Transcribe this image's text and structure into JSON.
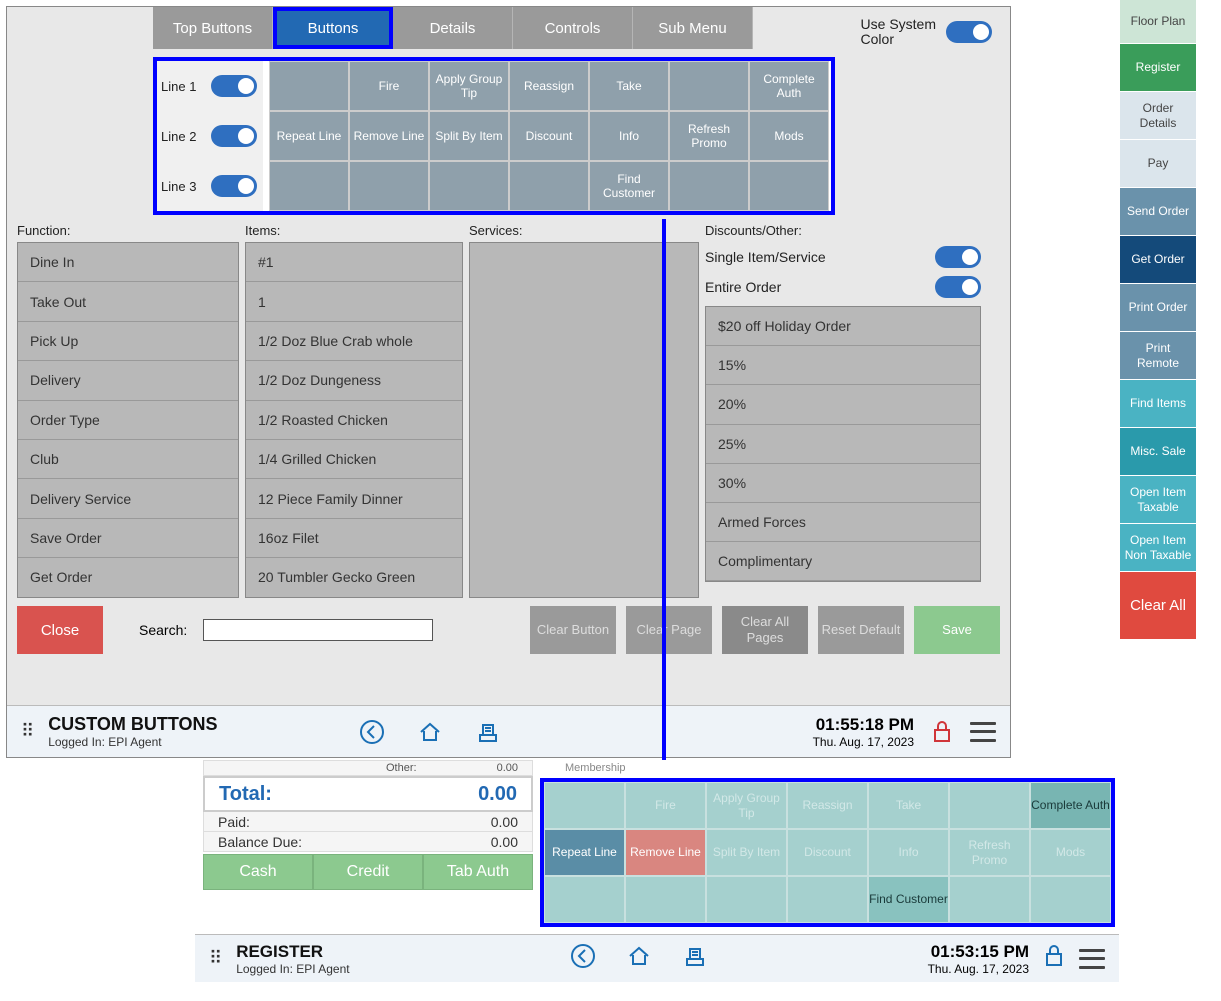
{
  "tabs": [
    "Top Buttons",
    "Buttons",
    "Details",
    "Controls",
    "Sub Menu"
  ],
  "activeTab": "Buttons",
  "systemColor": {
    "label": "Use System\nColor"
  },
  "lines": [
    {
      "label": "Line 1",
      "cells": [
        "",
        "Fire",
        "Apply Group Tip",
        "Reassign",
        "Take",
        "",
        "Complete Auth"
      ]
    },
    {
      "label": "Line 2",
      "cells": [
        "Repeat Line",
        "Remove Line",
        "Split By Item",
        "Discount",
        "Info",
        "Refresh Promo",
        "Mods"
      ]
    },
    {
      "label": "Line 3",
      "cells": [
        "",
        "",
        "",
        "",
        "Find Customer",
        "",
        ""
      ]
    }
  ],
  "columns": {
    "function": {
      "label": "Function:",
      "items": [
        "Dine In",
        "Take Out",
        "Pick Up",
        "Delivery",
        "Order Type",
        "Club",
        "Delivery Service",
        "Save Order",
        "Get Order"
      ]
    },
    "items": {
      "label": "Items:",
      "items": [
        "#1",
        "1",
        "1/2 Doz Blue Crab whole",
        "1/2 Doz Dungeness",
        "1/2 Roasted Chicken",
        "1/4 Grilled Chicken",
        "12 Piece Family Dinner",
        "16oz Filet",
        "20 Tumbler Gecko Green"
      ]
    },
    "services": {
      "label": "Services:",
      "items": []
    },
    "discounts": {
      "label": "Discounts/Other:",
      "single": "Single Item/Service",
      "entire": "Entire Order",
      "items": [
        "$20 off Holiday Order",
        "15%",
        "20%",
        "25%",
        "30%",
        "Armed Forces",
        "Complimentary"
      ]
    }
  },
  "actions": {
    "close": "Close",
    "searchLabel": "Search:",
    "clearButton": "Clear Button",
    "clearPage": "Clear Page",
    "clearAllPages": "Clear All Pages",
    "resetDefault": "Reset Default",
    "save": "Save"
  },
  "status1": {
    "title": "CUSTOM BUTTONS",
    "sub": "Logged In:  EPI Agent",
    "time": "01:55:18 PM",
    "date": "Thu. Aug. 17, 2023"
  },
  "panel2": {
    "topOther": "Other:",
    "topVal": "0.00",
    "totals": [
      {
        "label": "Total:",
        "value": "0.00",
        "big": true
      },
      {
        "label": "Paid:",
        "value": "0.00"
      },
      {
        "label": "Balance Due:",
        "value": "0.00"
      }
    ],
    "payButtons": [
      "Cash",
      "Credit",
      "Tab Auth"
    ],
    "tealRows": [
      [
        {
          "t": ""
        },
        {
          "t": "Fire"
        },
        {
          "t": "Apply Group Tip"
        },
        {
          "t": "Reassign"
        },
        {
          "t": "Take"
        },
        {
          "t": ""
        },
        {
          "t": "Complete Auth",
          "cls": "comp"
        }
      ],
      [
        {
          "t": "Repeat Line",
          "cls": "darkblue"
        },
        {
          "t": "Remove Line",
          "cls": "red"
        },
        {
          "t": "Split By Item"
        },
        {
          "t": "Discount"
        },
        {
          "t": "Info"
        },
        {
          "t": "Refresh Promo"
        },
        {
          "t": "Mods"
        }
      ],
      [
        {
          "t": ""
        },
        {
          "t": ""
        },
        {
          "t": ""
        },
        {
          "t": ""
        },
        {
          "t": "Find Customer",
          "cls": "darktext"
        },
        {
          "t": ""
        },
        {
          "t": ""
        }
      ]
    ],
    "membership": "Membership"
  },
  "status2": {
    "title": "REGISTER",
    "sub": "Logged In:  EPI Agent",
    "time": "01:53:15 PM",
    "date": "Thu. Aug. 17, 2023"
  },
  "sideNav": [
    {
      "t": "Floor Plan",
      "cls": "floor"
    },
    {
      "t": "Register",
      "cls": "reg"
    },
    {
      "t": "Order Details",
      "cls": "light"
    },
    {
      "t": "Pay",
      "cls": "light"
    },
    {
      "t": "Send Order",
      "cls": "blue"
    },
    {
      "t": "Get Order",
      "cls": "dblue"
    },
    {
      "t": "Print Order",
      "cls": "blue"
    },
    {
      "t": "Print Remote",
      "cls": "blue"
    },
    {
      "t": "Find Items",
      "cls": "teal"
    },
    {
      "t": "Misc. Sale",
      "cls": "dteal"
    },
    {
      "t": "Open Item Taxable",
      "cls": "teal"
    },
    {
      "t": "Open Item Non Taxable",
      "cls": "teal"
    },
    {
      "t": "Clear All",
      "cls": "clearall"
    }
  ]
}
